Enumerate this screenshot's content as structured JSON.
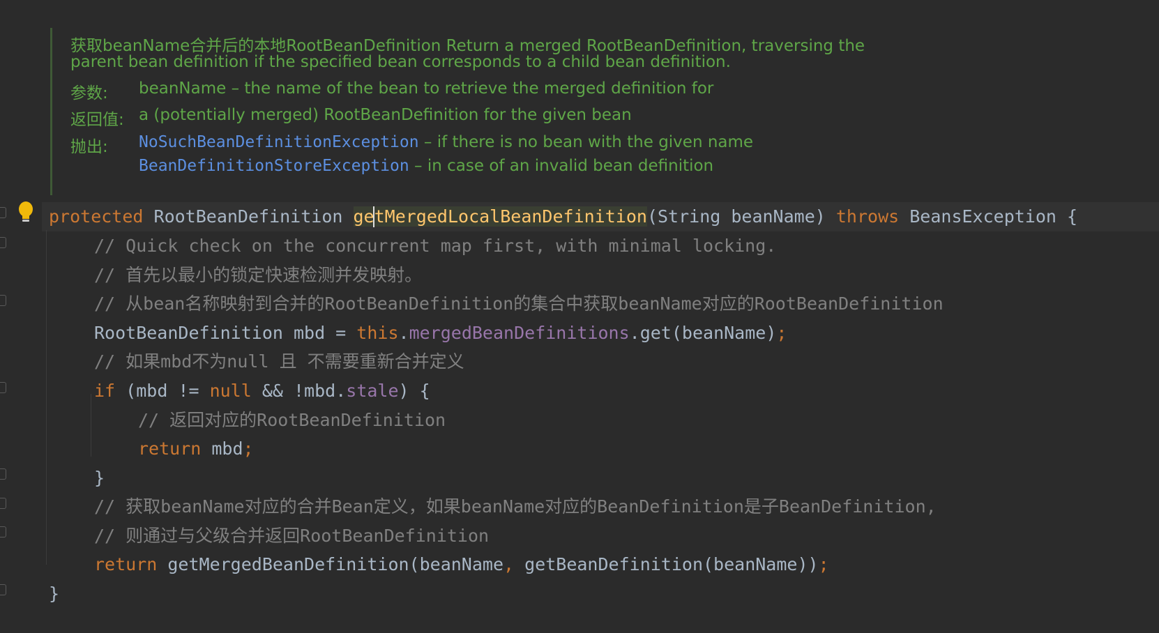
{
  "doc": {
    "summary_1": "获取beanName合并后的本地RootBeanDefinition Return a merged RootBeanDefinition, traversing the",
    "summary_2": "parent bean definition if the specified bean corresponds to a child bean definition.",
    "param_label": "参数:",
    "param_text": "beanName – the name of the bean to retrieve the merged definition for",
    "return_label": "返回值:",
    "return_text": "a (potentially merged) RootBeanDefinition for the given bean",
    "throws_label": "抛出:",
    "throws": [
      {
        "exception": "NoSuchBeanDefinitionException",
        "text": " – if there is no bean with the given name"
      },
      {
        "exception": "BeanDefinitionStoreException",
        "text": " – in case of an invalid bean definition"
      }
    ]
  },
  "code": {
    "sig": {
      "protected": "protected",
      "type": " RootBeanDefinition ",
      "method": "getMergedLocalBeanDefinition",
      "params": "(String beanName) ",
      "throws": "throws",
      "exc": " BeansException {"
    },
    "c1": "// Quick check on the concurrent map first, with minimal locking.",
    "c2": "// 首先以最小的锁定快速检测并发映射。",
    "c3": "// 从bean名称映射到合并的RootBeanDefinition的集合中获取beanName对应的RootBeanDefinition",
    "l4a": "RootBeanDefinition mbd = ",
    "l4this": "this",
    "l4dot": ".",
    "l4field": "mergedBeanDefinitions",
    "l4b": ".get(beanName)",
    "l4semi": ";",
    "c5": "// 如果mbd不为null 且 不需要重新合并定义",
    "l6if": "if",
    "l6a": " (mbd != ",
    "l6null": "null",
    "l6b": " && !mbd.",
    "l6field": "stale",
    "l6c": ") {",
    "c7": "// 返回对应的RootBeanDefinition",
    "l8ret": "return",
    "l8a": " mbd",
    "l8semi": ";",
    "l9": "}",
    "c10": "// 获取beanName对应的合并Bean定义，如果beanName对应的BeanDefinition是子BeanDefinition,",
    "c11": "// 则通过与父级合并返回RootBeanDefinition",
    "l12ret": "return",
    "l12a": " getMergedBeanDefinition(beanName",
    "l12comma": ",",
    "l12b": " getBeanDefinition(beanName))",
    "l12semi": ";",
    "l13": "}"
  },
  "colors": {
    "background": "#2b2b2b",
    "keyword": "#cc7832",
    "comment": "#808080",
    "field": "#9876aa",
    "method": "#ffc66d",
    "doc_text": "#5fa648",
    "doc_link": "#5c8fe0"
  },
  "icons": {
    "bulb": "lightbulb-icon"
  }
}
